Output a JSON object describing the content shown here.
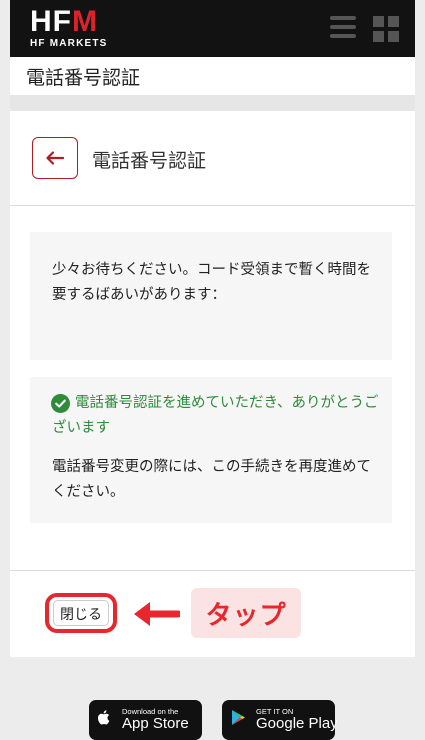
{
  "brand": {
    "logo_main": "HF",
    "logo_accent": "M",
    "logo_sub": "HF MARKETS"
  },
  "page": {
    "title": "電話番号認証"
  },
  "card": {
    "title": "電話番号認証",
    "wait_message": "少々お待ちください。コード受領まで暫く時間を要するばあいがあります：",
    "success_message": "電話番号認証を進めていただき、ありがとうございます",
    "info_message": "電話番号変更の際には、この手続きを再度進めてください。",
    "close_label": "閉じる"
  },
  "annotation": {
    "label": "タップ"
  },
  "stores": {
    "apple": {
      "small": "Download on the",
      "large": "App Store"
    },
    "google": {
      "small": "GET IT ON",
      "large": "Google Play"
    }
  },
  "colors": {
    "accent": "#b01c24",
    "success": "#2e8b3a",
    "annotation": "#e8262e"
  },
  "icons": [
    "menu-icon",
    "grid-icon",
    "arrow-left-icon",
    "check-circle-icon",
    "arrow-right-icon",
    "apple-icon",
    "play-icon"
  ]
}
